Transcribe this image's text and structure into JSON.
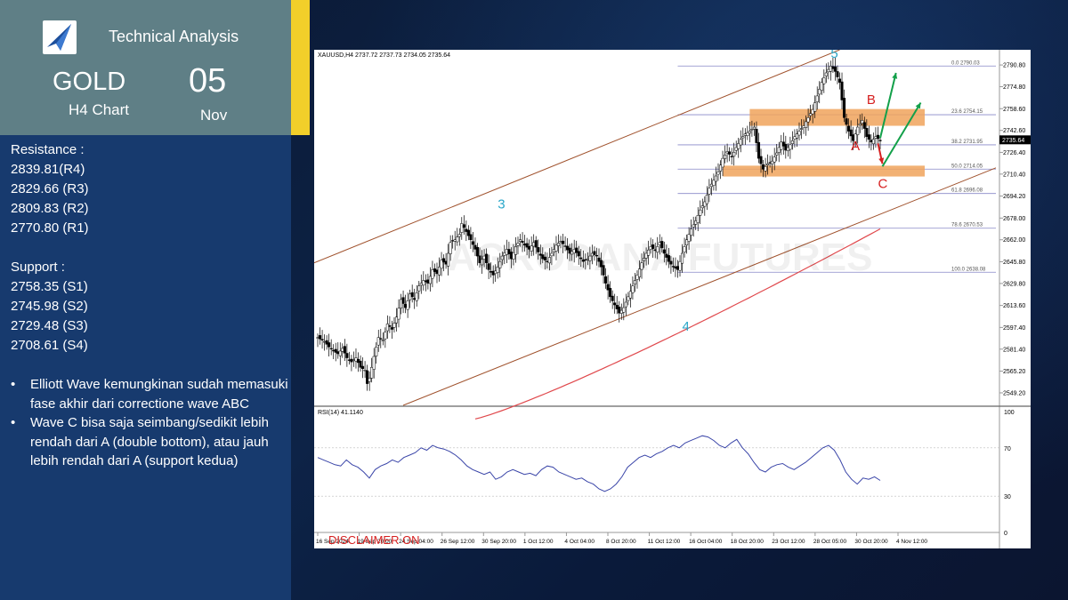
{
  "header": {
    "title": "Technical Analysis",
    "symbol": "GOLD",
    "timeframe": "H4 Chart",
    "day": "05",
    "month": "Nov"
  },
  "resistance": {
    "heading": "Resistance :",
    "levels": [
      "2839.81(R4)",
      "2829.66 (R3)",
      "2809.83 (R2)",
      "2770.80 (R1)"
    ]
  },
  "support": {
    "heading": "Support :",
    "levels": [
      "2758.35 (S1)",
      "2745.98 (S2)",
      "2729.48 (S3)",
      "2708.61 (S4)"
    ]
  },
  "notes": [
    "Elliott Wave kemungkinan sudah memasuki fase akhir dari correctione wave ABC",
    "Wave C bisa saja seimbang/sedikit lebih rendah dari A (double bottom), atau jauh lebih rendah dari A (support kedua)"
  ],
  "colors": {
    "panel": "#173a6e",
    "header_box": "#5f7f86",
    "accent": "#f2cf2a",
    "zone": "#f0a35c",
    "wave_label": "#2aa7c9",
    "abc_label": "#d62020",
    "channel": "#a0522d",
    "ma": "#e0484c",
    "rsi": "#3a45a8",
    "fib": "#8888c8",
    "up_arrow": "#13a04a"
  },
  "chart_data": [
    {
      "type": "candlestick",
      "header": "XAUUSD,H4  2737.72 2737.73 2734.05 2735.64",
      "last_price": "2735.64",
      "price_ticks": [
        "2790.80",
        "2774.80",
        "2758.60",
        "2742.60",
        "2726.40",
        "2710.40",
        "2694.20",
        "2678.00",
        "2662.00",
        "2645.80",
        "2629.80",
        "2613.60",
        "2597.40",
        "2581.40",
        "2565.20",
        "2549.20"
      ],
      "x_ticks": [
        "16 Sep 2024",
        "19 Sep 20:00",
        "24 Sep 04:00",
        "26 Sep 12:00",
        "30 Sep 20:00",
        "1 Oct 12:00",
        "4 Oct 04:00",
        "8 Oct 20:00",
        "11 Oct 12:00",
        "16 Oct 04:00",
        "18 Oct 20:00",
        "23 Oct 12:00",
        "28 Oct 05:00",
        "30 Oct 20:00",
        "4 Nov 12:00"
      ],
      "ylim": [
        2540,
        2802
      ],
      "fib_levels": [
        {
          "label": "0.0",
          "price": "2790.03"
        },
        {
          "label": "23.6",
          "price": "2754.15"
        },
        {
          "label": "38.2",
          "price": "2731.95"
        },
        {
          "label": "50.0",
          "price": "2714.05"
        },
        {
          "label": "61.8",
          "price": "2696.08"
        },
        {
          "label": "78.6",
          "price": "2670.53"
        },
        {
          "label": "100.0",
          "price": "2638.08"
        }
      ],
      "wave_labels": [
        "3",
        "4",
        "5"
      ],
      "abc_labels": [
        "A",
        "B",
        "C"
      ],
      "watermark": "AGRODANA FUTURES",
      "disclaimer": "DISCLAIMER ON",
      "close_path": [
        [
          0,
          2590
        ],
        [
          3,
          2587
        ],
        [
          5,
          2583
        ],
        [
          7,
          2580
        ],
        [
          9,
          2578
        ],
        [
          11,
          2582
        ],
        [
          13,
          2575
        ],
        [
          15,
          2572
        ],
        [
          17,
          2575
        ],
        [
          19,
          2568
        ],
        [
          21,
          2566
        ],
        [
          22,
          2556
        ],
        [
          23,
          2560
        ],
        [
          25,
          2576
        ],
        [
          27,
          2590
        ],
        [
          29,
          2588
        ],
        [
          31,
          2600
        ],
        [
          33,
          2596
        ],
        [
          35,
          2605
        ],
        [
          37,
          2618
        ],
        [
          39,
          2612
        ],
        [
          41,
          2622
        ],
        [
          43,
          2618
        ],
        [
          45,
          2628
        ],
        [
          47,
          2632
        ],
        [
          49,
          2630
        ],
        [
          51,
          2640
        ],
        [
          53,
          2637
        ],
        [
          55,
          2647
        ],
        [
          57,
          2644
        ],
        [
          59,
          2660
        ],
        [
          61,
          2662
        ],
        [
          63,
          2666
        ],
        [
          64,
          2674
        ],
        [
          66,
          2668
        ],
        [
          68,
          2662
        ],
        [
          70,
          2655
        ],
        [
          72,
          2645
        ],
        [
          74,
          2650
        ],
        [
          76,
          2640
        ],
        [
          78,
          2636
        ],
        [
          80,
          2642
        ],
        [
          82,
          2650
        ],
        [
          84,
          2655
        ],
        [
          86,
          2648
        ],
        [
          88,
          2657
        ],
        [
          90,
          2662
        ],
        [
          92,
          2658
        ],
        [
          94,
          2655
        ],
        [
          96,
          2660
        ],
        [
          98,
          2653
        ],
        [
          100,
          2648
        ],
        [
          102,
          2646
        ],
        [
          104,
          2652
        ],
        [
          106,
          2658
        ],
        [
          108,
          2661
        ],
        [
          110,
          2657
        ],
        [
          112,
          2652
        ],
        [
          114,
          2655
        ],
        [
          116,
          2650
        ],
        [
          118,
          2646
        ],
        [
          120,
          2648
        ],
        [
          122,
          2652
        ],
        [
          124,
          2650
        ],
        [
          126,
          2642
        ],
        [
          128,
          2630
        ],
        [
          130,
          2620
        ],
        [
          132,
          2614
        ],
        [
          134,
          2608
        ],
        [
          136,
          2612
        ],
        [
          138,
          2620
        ],
        [
          140,
          2628
        ],
        [
          142,
          2636
        ],
        [
          144,
          2645
        ],
        [
          146,
          2652
        ],
        [
          148,
          2657
        ],
        [
          150,
          2654
        ],
        [
          152,
          2660
        ],
        [
          154,
          2652
        ],
        [
          156,
          2646
        ],
        [
          158,
          2642
        ],
        [
          160,
          2640
        ],
        [
          162,
          2652
        ],
        [
          164,
          2662
        ],
        [
          166,
          2670
        ],
        [
          168,
          2676
        ],
        [
          170,
          2684
        ],
        [
          172,
          2690
        ],
        [
          174,
          2700
        ],
        [
          176,
          2706
        ],
        [
          178,
          2712
        ],
        [
          180,
          2722
        ],
        [
          182,
          2727
        ],
        [
          184,
          2723
        ],
        [
          186,
          2730
        ],
        [
          188,
          2736
        ],
        [
          190,
          2740
        ],
        [
          192,
          2742
        ],
        [
          194,
          2745
        ],
        [
          196,
          2722
        ],
        [
          198,
          2714
        ],
        [
          200,
          2718
        ],
        [
          202,
          2720
        ],
        [
          204,
          2726
        ],
        [
          206,
          2734
        ],
        [
          208,
          2728
        ],
        [
          210,
          2732
        ],
        [
          212,
          2738
        ],
        [
          214,
          2742
        ],
        [
          216,
          2746
        ],
        [
          218,
          2752
        ],
        [
          220,
          2758
        ],
        [
          222,
          2768
        ],
        [
          224,
          2778
        ],
        [
          226,
          2785
        ],
        [
          228,
          2790
        ],
        [
          230,
          2786
        ],
        [
          232,
          2778
        ],
        [
          234,
          2752
        ],
        [
          236,
          2742
        ],
        [
          238,
          2735
        ],
        [
          240,
          2745
        ],
        [
          242,
          2750
        ],
        [
          244,
          2738
        ],
        [
          246,
          2734
        ],
        [
          248,
          2738
        ],
        [
          250,
          2735
        ]
      ]
    },
    {
      "type": "line",
      "header": "RSI(14) 41.1140",
      "ylim": [
        0,
        100
      ],
      "y_ticks": [
        "100",
        "70",
        "30",
        "0"
      ],
      "values": [
        62,
        60,
        58,
        56,
        55,
        60,
        56,
        54,
        50,
        45,
        52,
        55,
        57,
        60,
        58,
        62,
        64,
        66,
        70,
        68,
        72,
        70,
        69,
        67,
        64,
        60,
        55,
        52,
        50,
        48,
        50,
        44,
        46,
        50,
        52,
        50,
        48,
        49,
        47,
        52,
        55,
        54,
        50,
        48,
        46,
        44,
        45,
        42,
        40,
        36,
        34,
        36,
        40,
        46,
        54,
        58,
        62,
        64,
        62,
        65,
        67,
        70,
        72,
        70,
        74,
        76,
        78,
        80,
        79,
        76,
        72,
        70,
        74,
        77,
        70,
        65,
        58,
        52,
        50,
        54,
        56,
        57,
        54,
        52,
        55,
        58,
        62,
        66,
        70,
        72,
        68,
        60,
        50,
        44,
        40,
        45,
        44,
        46,
        43
      ]
    }
  ]
}
